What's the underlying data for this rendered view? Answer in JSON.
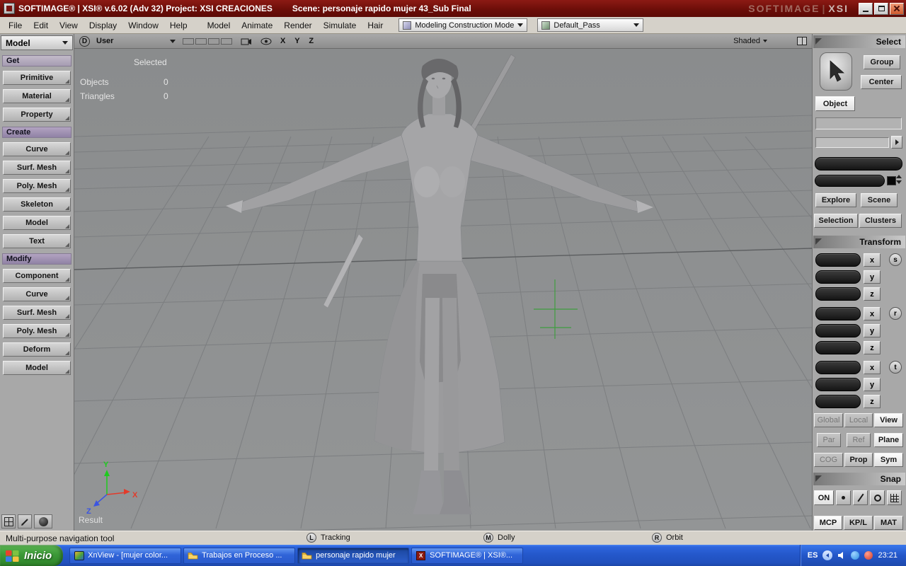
{
  "titlebar": {
    "title": "SOFTIMAGE® | XSI® v.6.02 (Adv 32) Project: XSI CREACIONES",
    "scene": "Scene: personaje rapido mujer 43_Sub Final",
    "watermark_brand": "SOFTIMAGE",
    "watermark_product": "XSI"
  },
  "menubar": {
    "menus": [
      "File",
      "Edit",
      "View",
      "Display",
      "Window",
      "Help"
    ],
    "modules": [
      "Model",
      "Animate",
      "Render",
      "Simulate",
      "Hair"
    ],
    "construction_mode": "Modeling Construction Mode",
    "pass": "Default_Pass"
  },
  "left_panel": {
    "module_selector": "Model",
    "get_header": "Get",
    "get_items": [
      "Primitive",
      "Material",
      "Property"
    ],
    "create_header": "Create",
    "create_items": [
      "Curve",
      "Surf. Mesh",
      "Poly. Mesh",
      "Skeleton",
      "Model",
      "Text"
    ],
    "modify_header": "Modify",
    "modify_items": [
      "Component",
      "Curve",
      "Surf. Mesh",
      "Poly. Mesh",
      "Deform",
      "Model"
    ]
  },
  "viewport": {
    "view_letter": "D",
    "camera_name": "User",
    "axis_labels": "X Y Z",
    "display_mode": "Shaded",
    "hud": {
      "selected": "Selected",
      "objects_label": "Objects",
      "objects_value": "0",
      "triangles_label": "Triangles",
      "triangles_value": "0"
    },
    "result_label": "Result",
    "triad": {
      "x": "X",
      "y": "Y",
      "z": "Z"
    },
    "mouse_hints": [
      {
        "button": "L",
        "label": "Tracking"
      },
      {
        "button": "M",
        "label": "Dolly"
      },
      {
        "button": "R",
        "label": "Orbit"
      }
    ]
  },
  "right_panel": {
    "select_header": "Select",
    "group": "Group",
    "center": "Center",
    "object": "Object",
    "explore": "Explore",
    "scene": "Scene",
    "selection": "Selection",
    "clusters": "Clusters",
    "transform_header": "Transform",
    "transform_groups": [
      {
        "letter": "s",
        "axes": [
          "x",
          "y",
          "z"
        ]
      },
      {
        "letter": "r",
        "axes": [
          "x",
          "y",
          "z"
        ]
      },
      {
        "letter": "t",
        "axes": [
          "x",
          "y",
          "z"
        ]
      }
    ],
    "space_modes": [
      "Global",
      "Local",
      "View"
    ],
    "ref_modes": [
      "Par",
      "Ref",
      "Plane"
    ],
    "cog_modes": [
      "COG",
      "Prop",
      "Sym"
    ],
    "snap_header": "Snap",
    "snap_on": "ON",
    "panel_tabs": [
      "MCP",
      "KP/L",
      "MAT"
    ]
  },
  "statusbar": {
    "tooltip": "Multi-purpose navigation tool"
  },
  "taskbar": {
    "start_label": "Inicio",
    "items": [
      {
        "label": "XnView - [mujer color..."
      },
      {
        "label": "Trabajos en Proceso ..."
      },
      {
        "label": "personaje rapido mujer"
      },
      {
        "label": "SOFTIMAGE® | XSI®..."
      }
    ],
    "tray": {
      "language": "ES",
      "time": "23:21"
    }
  },
  "colors": {
    "titlebar_red": "#6a0d08",
    "panel_gray": "#a8a8a8",
    "viewport_gray": "#8f9193",
    "section_header_purple": "#9a8cae",
    "taskbar_blue": "#2458cb",
    "start_green": "#3c9a38",
    "cursor_green": "#3f9e3f"
  },
  "icons": {
    "app": "xsi-logo-icon",
    "construction_mode": "construction-mode-icon",
    "pass": "render-pass-icon",
    "viewport_camera": "camera-icon",
    "viewport_visibility": "eye-icon",
    "select_tool": "cursor-arrow-icon",
    "folder": "folder-icon",
    "xnview": "xnview-icon",
    "start_flag": "windows-flag-icon",
    "volume": "speaker-icon"
  }
}
